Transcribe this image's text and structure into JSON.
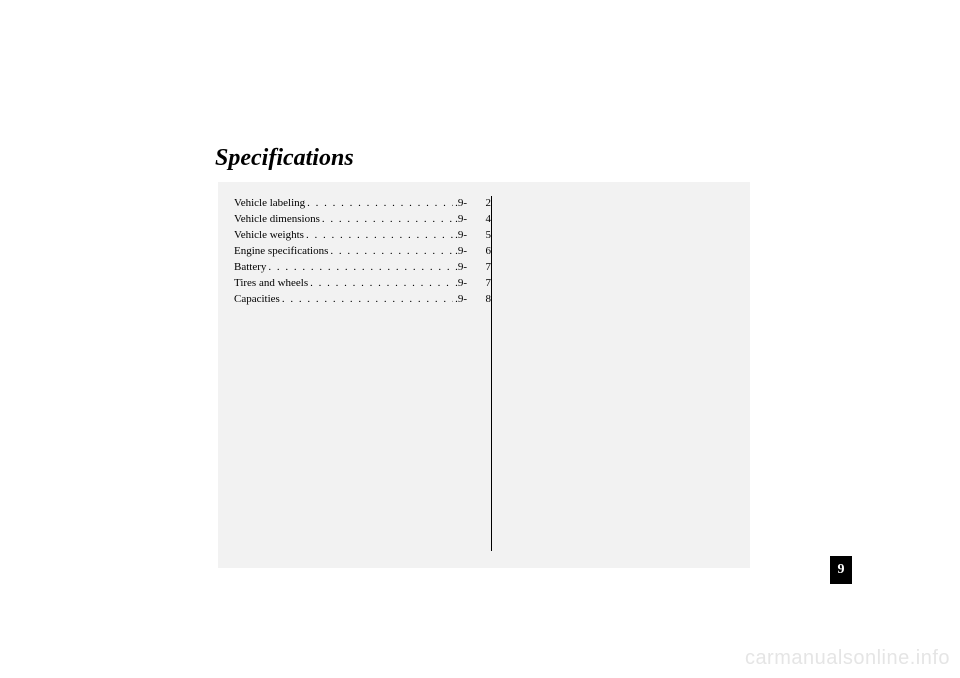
{
  "title": "Specifications",
  "toc": [
    {
      "label": "Vehicle labeling",
      "section": ".9-",
      "page": "2"
    },
    {
      "label": "Vehicle dimensions",
      "section": ".9-",
      "page": "4"
    },
    {
      "label": "Vehicle weights",
      "section": ".9-",
      "page": "5"
    },
    {
      "label": "Engine specifications",
      "section": ".9-",
      "page": "6"
    },
    {
      "label": "Battery",
      "section": ".9-",
      "page": "7"
    },
    {
      "label": "Tires and wheels",
      "section": ".9-",
      "page": "7"
    },
    {
      "label": "Capacities",
      "section": ".9-",
      "page": "8"
    }
  ],
  "page_tab": "9",
  "watermark": "carmanualsonline.info",
  "dots": " . . . . . . . . . . . . . . . . . . . . . . . . . . . . . . . . . . . . . . . . . ."
}
